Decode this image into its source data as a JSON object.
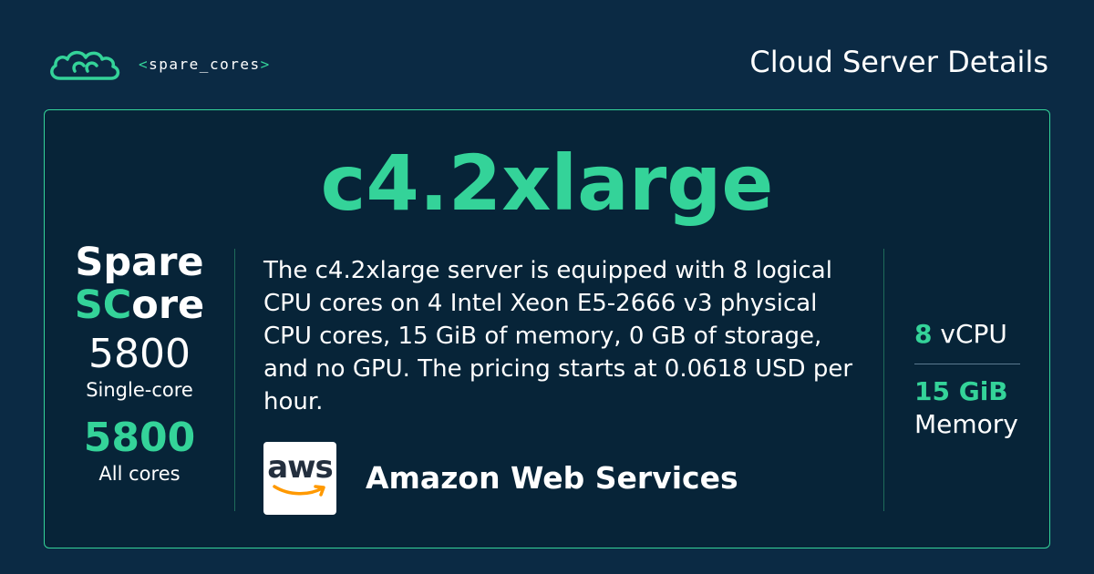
{
  "header": {
    "logo_text": "spare_cores",
    "logo_open": "<",
    "logo_close": ">",
    "page_title": "Cloud Server Details"
  },
  "server": {
    "name": "c4.2xlarge",
    "description": "The c4.2xlarge server is equipped with 8 logical CPU cores on 4 Intel Xeon E5-2666 v3 physical CPU cores, 15 GiB of memory, 0 GB of storage, and no GPU. The pricing starts at 0.0618 USD per hour."
  },
  "score": {
    "title_line1": "Spare",
    "title_sc": "SC",
    "title_ore": "ore",
    "single_core_value": "5800",
    "single_core_label": "Single-core",
    "all_cores_value": "5800",
    "all_cores_label": "All cores"
  },
  "vendor": {
    "logo_text": "aws",
    "name": "Amazon Web Services"
  },
  "specs": {
    "vcpu_value": "8",
    "vcpu_label": "vCPU",
    "memory_value": "15 GiB",
    "memory_label": "Memory"
  },
  "colors": {
    "background": "#0b2a44",
    "card": "#072438",
    "accent": "#34d399"
  }
}
